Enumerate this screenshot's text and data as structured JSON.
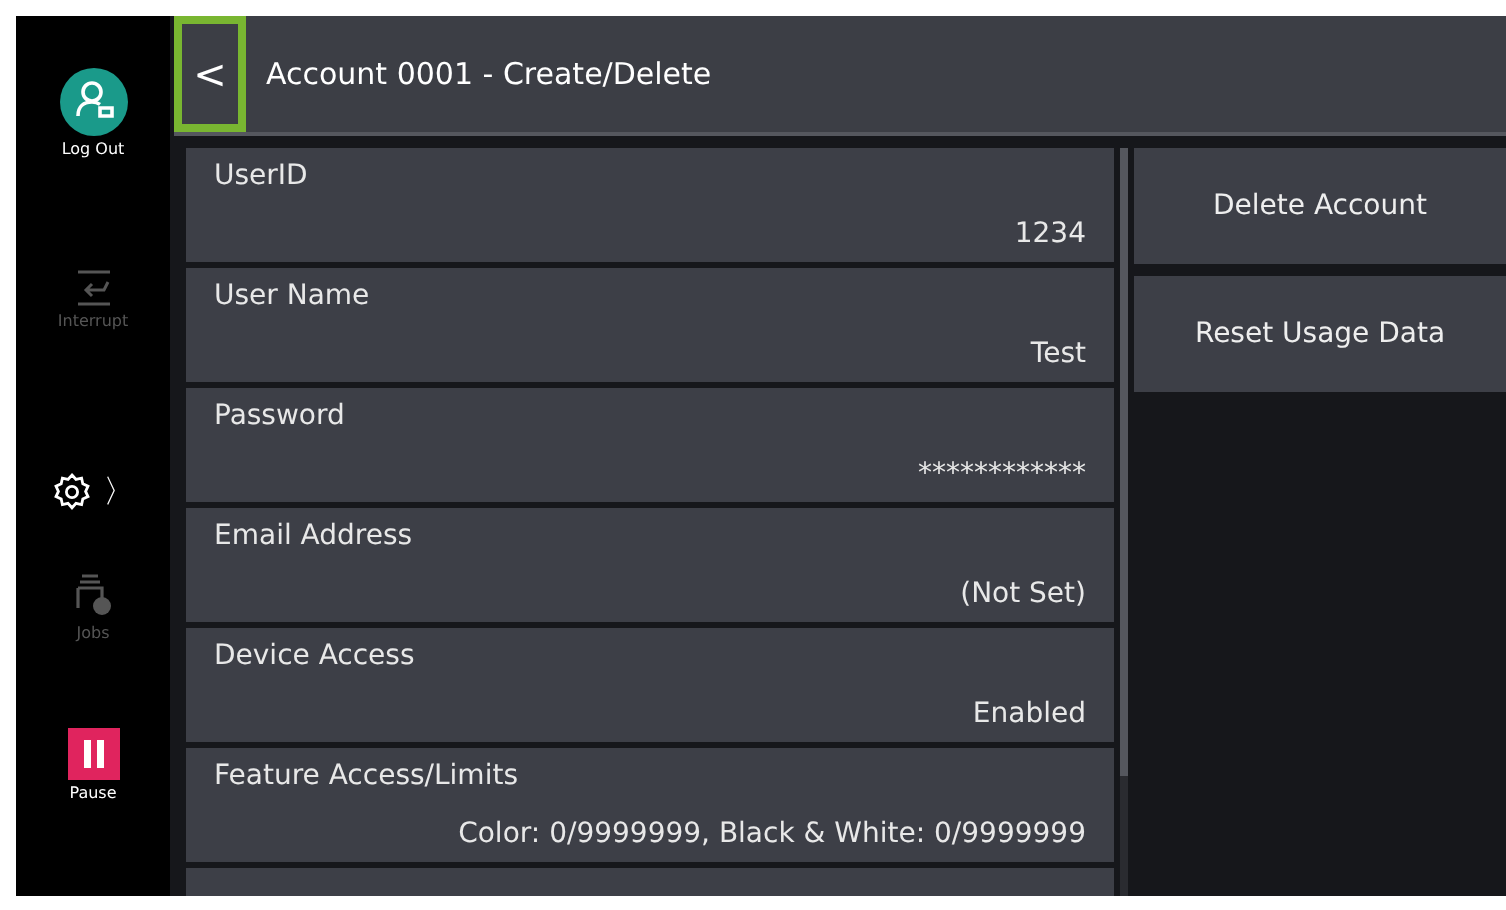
{
  "sidebar": {
    "items": [
      {
        "kind": "logout",
        "label": "Log Out",
        "disabled": false
      },
      {
        "kind": "interrupt",
        "label": "Interrupt",
        "disabled": true
      },
      {
        "kind": "settings",
        "chevron": "〉",
        "disabled": false
      },
      {
        "kind": "jobs",
        "label": "Jobs",
        "disabled": true
      },
      {
        "kind": "pause",
        "label": "Pause",
        "disabled": false
      }
    ]
  },
  "header": {
    "back": "<",
    "title": "Account 0001 - Create/Delete",
    "back_highlighted": true
  },
  "fields": [
    {
      "label": "UserID",
      "value": "1234"
    },
    {
      "label": "User Name",
      "value": "Test"
    },
    {
      "label": "Password",
      "value": "************"
    },
    {
      "label": "Email Address",
      "value": "(Not Set)"
    },
    {
      "label": "Device Access",
      "value": "Enabled"
    },
    {
      "label": "Feature Access/Limits",
      "value": "Color: 0/9999999, Black & White: 0/9999999"
    }
  ],
  "actions": [
    "Delete Account",
    "Reset Usage Data"
  ]
}
